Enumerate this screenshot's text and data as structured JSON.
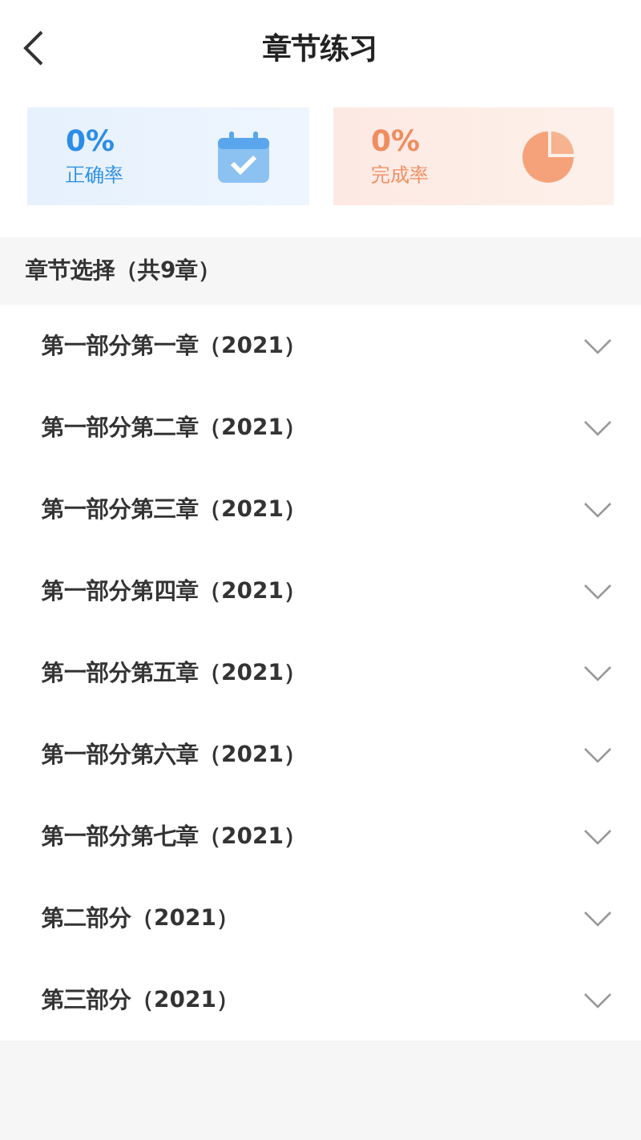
{
  "header": {
    "title": "章节练习"
  },
  "stats": [
    {
      "kind": "accuracy",
      "value": "0%",
      "label": "正确率"
    },
    {
      "kind": "completion",
      "value": "0%",
      "label": "完成率"
    }
  ],
  "section": {
    "title": "章节选择（共9章）"
  },
  "chapters": [
    {
      "title": "第一部分第一章（2021）",
      "expanded": false
    },
    {
      "title": "第一部分第二章（2021）",
      "expanded": false
    },
    {
      "title": "第一部分第三章（2021）",
      "expanded": false
    },
    {
      "title": "第一部分第四章（2021）",
      "expanded": false
    },
    {
      "title": "第一部分第五章（2021）",
      "expanded": false
    },
    {
      "title": "第一部分第六章（2021）",
      "expanded": false
    },
    {
      "title": "第一部分第七章（2021）",
      "expanded": false
    },
    {
      "title": "第二部分（2021）",
      "expanded": false
    },
    {
      "title": "第三部分（2021）",
      "expanded": false
    }
  ]
}
